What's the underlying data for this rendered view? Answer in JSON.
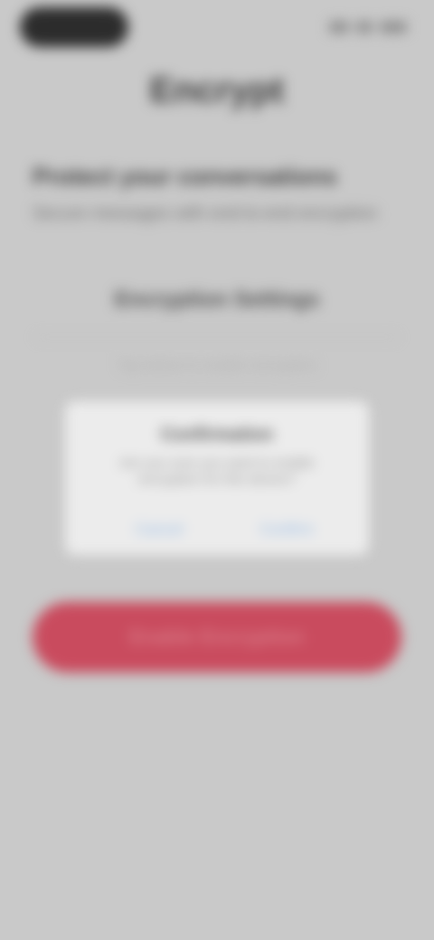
{
  "status_bar": {
    "time": "9:41"
  },
  "header": {
    "title": "Encrypt"
  },
  "section": {
    "title": "Protect your conversations",
    "subtitle": "Secure messages with end-to-end encryption"
  },
  "group": {
    "label": "Encryption Settings",
    "hint": "Tap below to enable encryption"
  },
  "dialog": {
    "title": "Confirmation",
    "message": "Are you sure you want to enable encryption for this device?",
    "cancel_label": "Cancel",
    "confirm_label": "Confirm"
  },
  "primary_action": {
    "label": "Enable Encryption"
  },
  "colors": {
    "accent": "#c94b5e",
    "dialog_link": "#8fb7e6",
    "background": "#c9c9c9"
  }
}
